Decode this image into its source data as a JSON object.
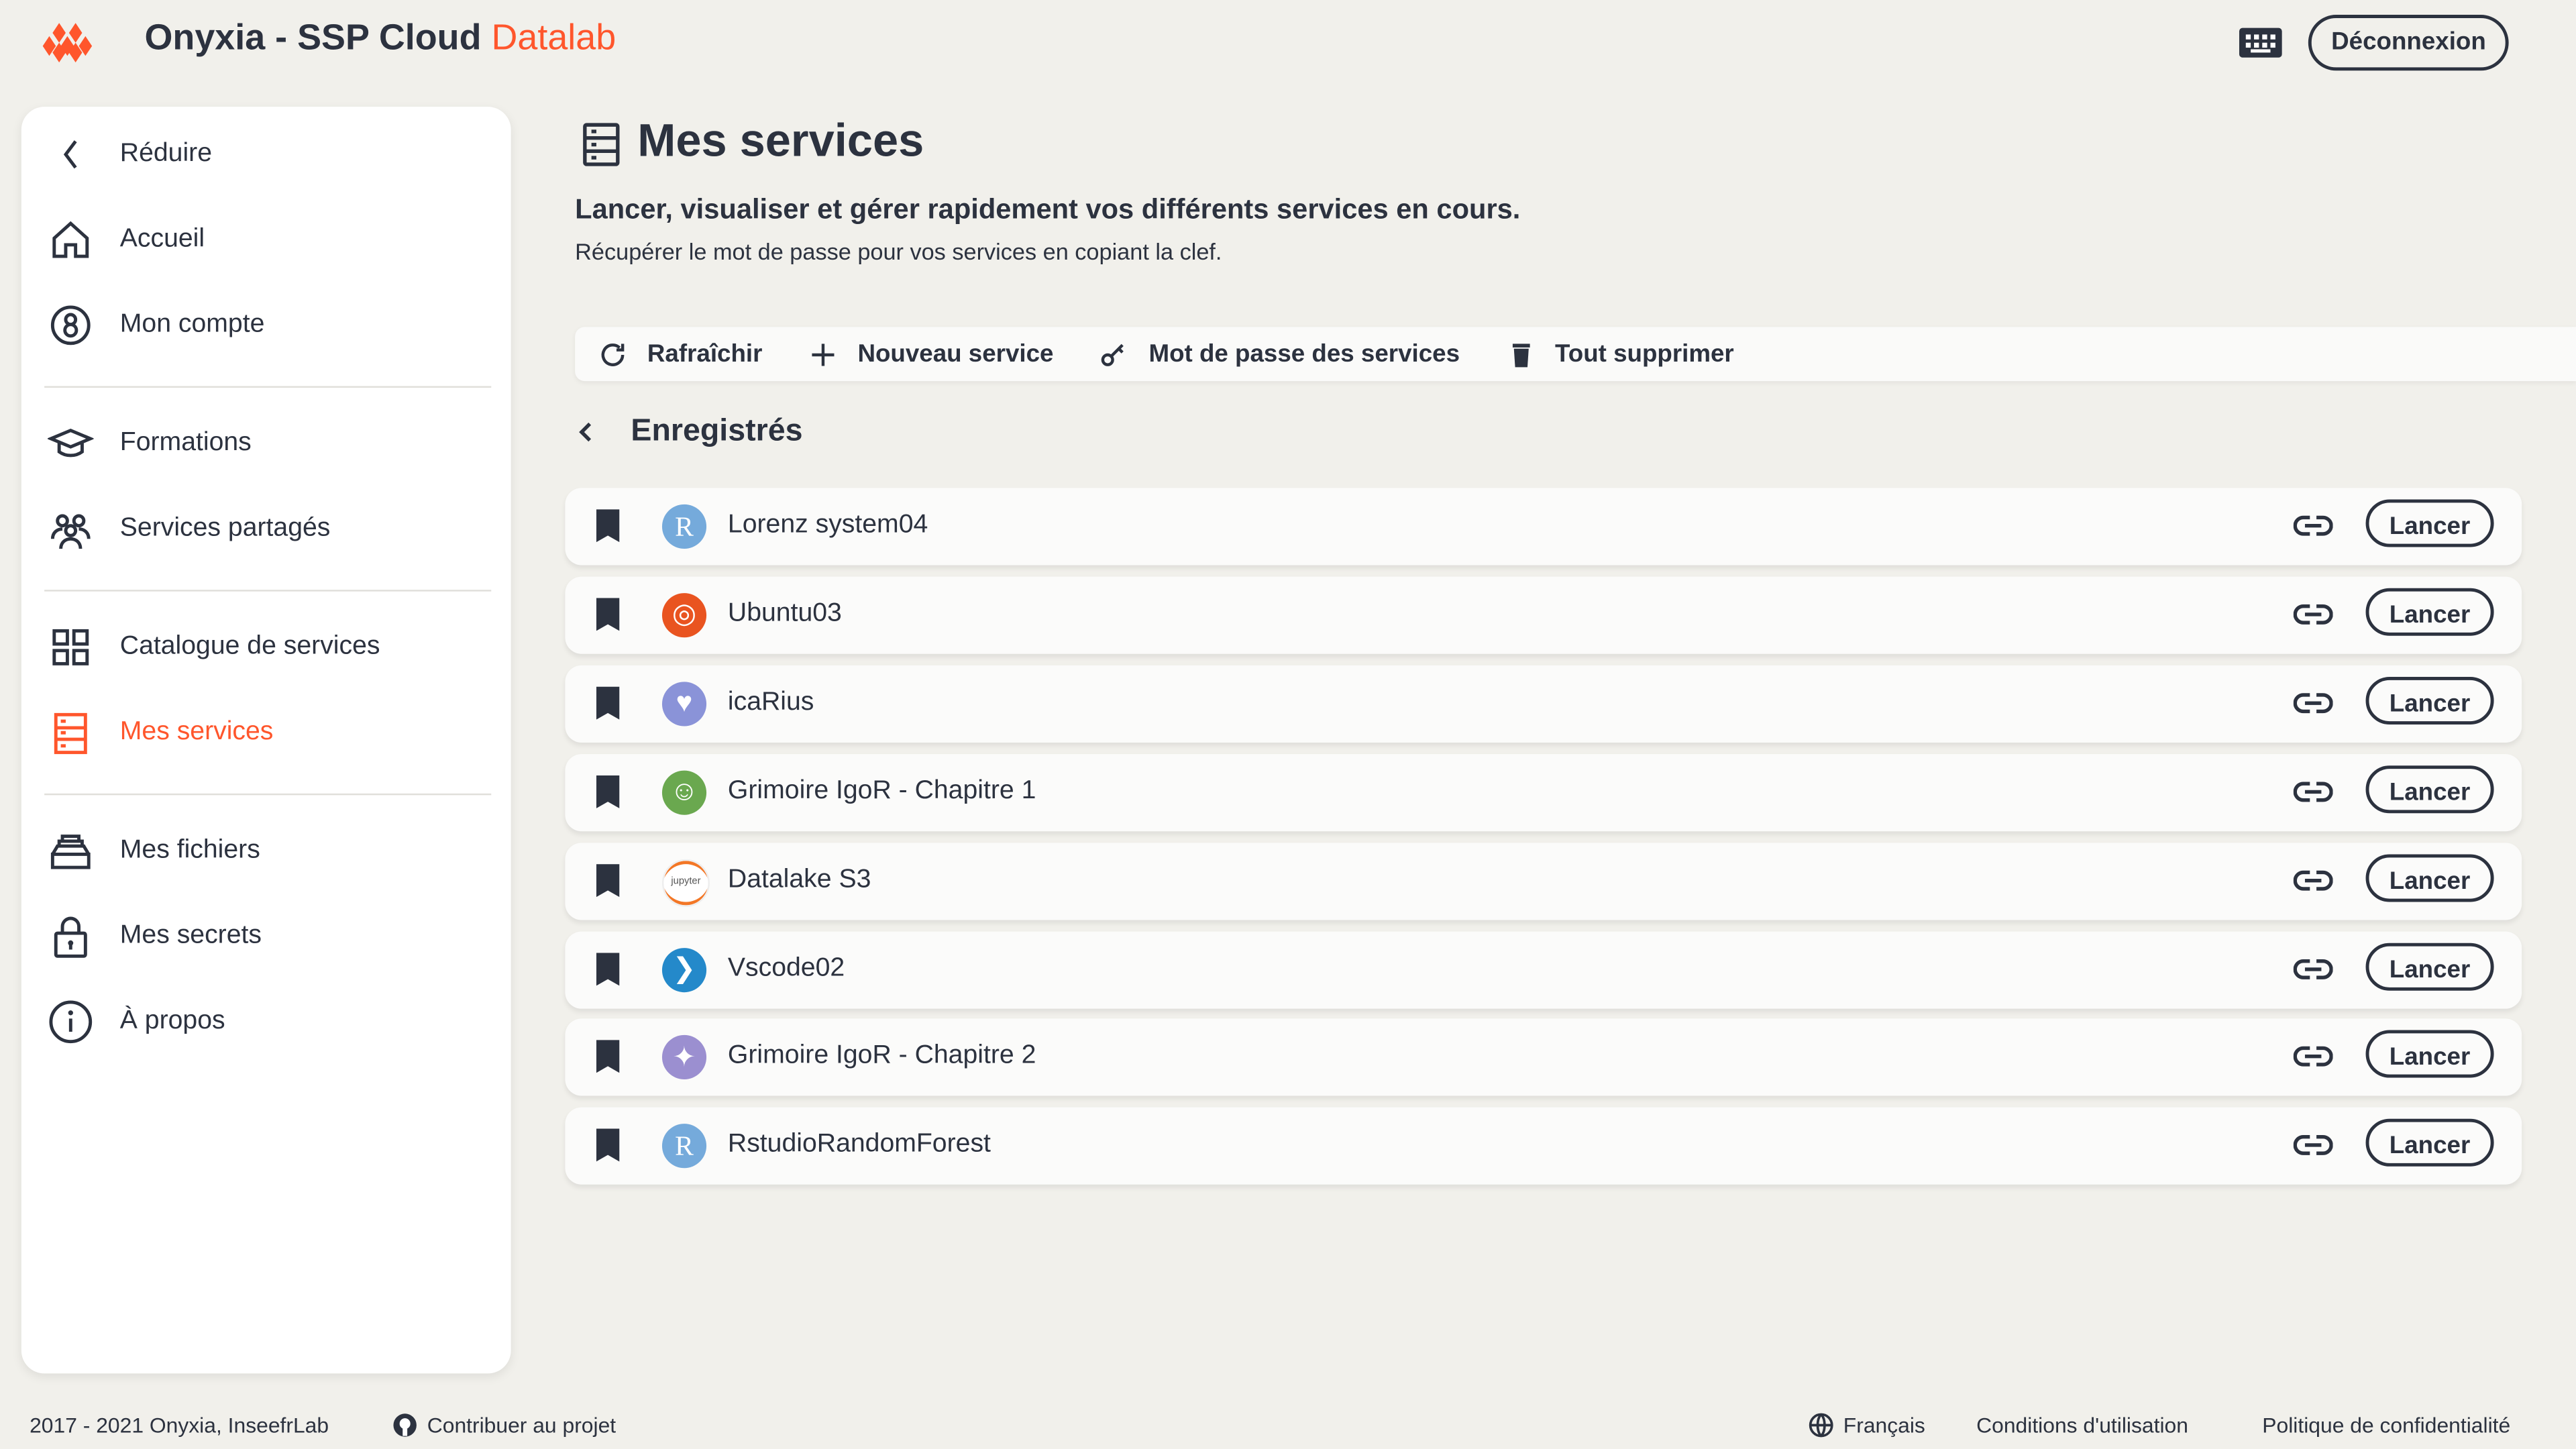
{
  "header": {
    "brand_a": "Onyxia - ",
    "brand_b": "SSP Cloud",
    "brand_c": " Datalab",
    "logout": "Déconnexion"
  },
  "sidebar": {
    "items": [
      {
        "label": "Réduire",
        "icon": "chevron-left"
      },
      {
        "label": "Accueil",
        "icon": "home"
      },
      {
        "label": "Mon compte",
        "icon": "account"
      },
      {
        "label": "Formations",
        "icon": "graduation-cap"
      },
      {
        "label": "Services partagés",
        "icon": "people"
      },
      {
        "label": "Catalogue de services",
        "icon": "grid"
      },
      {
        "label": "Mes services",
        "icon": "services",
        "active": true
      },
      {
        "label": "Mes fichiers",
        "icon": "files"
      },
      {
        "label": "Mes secrets",
        "icon": "lock"
      },
      {
        "label": "À propos",
        "icon": "info"
      }
    ]
  },
  "main": {
    "title": "Mes services",
    "subtitle": "Lancer, visualiser et gérer rapidement vos différents services en cours.",
    "help": "Récupérer le mot de passe pour vos services en copiant la clef.",
    "toolbar": [
      "Rafraîchir",
      "Nouveau service",
      "Mot de passe des services",
      "Tout supprimer"
    ],
    "section": "Enregistrés",
    "launch_label": "Lancer",
    "services": [
      {
        "name": "Lorenz system04",
        "icon": "rstudio",
        "color": "#75aadb"
      },
      {
        "name": "Ubuntu03",
        "icon": "ubuntu",
        "color": "#e95420"
      },
      {
        "name": "icaRius",
        "icon": "icarius",
        "color": "#8a93d8"
      },
      {
        "name": "Grimoire IgoR - Chapitre 1",
        "icon": "pixel-hero",
        "color": "#6aa84f"
      },
      {
        "name": "Datalake S3",
        "icon": "jupyter",
        "color": "#f37726"
      },
      {
        "name": "Vscode02",
        "icon": "vscode",
        "color": "#2489ca"
      },
      {
        "name": "Grimoire IgoR - Chapitre 2",
        "icon": "pixel-bird",
        "color": "#9b8fd0"
      },
      {
        "name": "RstudioRandomForest",
        "icon": "rstudio",
        "color": "#75aadb"
      }
    ]
  },
  "footer": {
    "copyright": "2017 - 2021 Onyxia, InseefrLab",
    "contribute": "Contribuer au projet",
    "language": "Français",
    "terms": "Conditions d'utilisation",
    "privacy": "Politique de confidentialité"
  },
  "colors": {
    "accent": "#ff562c",
    "text": "#2c323f",
    "background": "#f1f0eb"
  }
}
